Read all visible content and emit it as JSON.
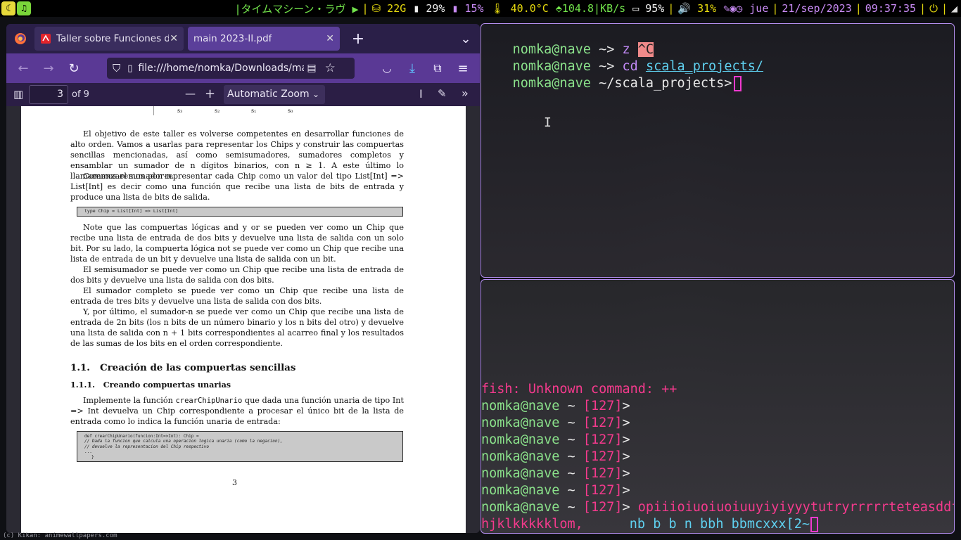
{
  "topbar": {
    "ws1_icon": "☾",
    "ws2_icon": "♫",
    "now_playing": "|タイムマシーン・ラヴ ▶",
    "disk": "⛁ 22G",
    "mem": "▮ 29%",
    "cpu": "▮ 15%",
    "temp": "🌡 40.0°C",
    "net": "⬘104.8|KB/s",
    "battery": "▭ 95%",
    "volume": "🔊 31%",
    "day": "jue",
    "date": "21/sep/2023",
    "time": "09:37:35",
    "power_icon": "⏻",
    "wifi_icon": "◢",
    "colors": {
      "pink": "#f53a8d",
      "yellow": "#e4d80e",
      "green": "#72e34b",
      "purple": "#c98bf5",
      "white": "#f0f0f0"
    }
  },
  "firefox": {
    "tabs": [
      {
        "label": "Taller sobre Funciones de A",
        "close": "✕"
      },
      {
        "label": "main 2023-II.pdf",
        "close": "✕"
      }
    ],
    "new_tab": "+",
    "tab_list": "⌄",
    "url": "file:///home/nomka/Downloads/ma",
    "pdf_toolbar": {
      "page_value": "3",
      "page_total": "of 9",
      "zoom": "Automatic Zoom",
      "zoom_out": "—",
      "zoom_in": "+"
    }
  },
  "pdf": {
    "signals": [
      "s₃",
      "s₂",
      "s₁",
      "s₀"
    ],
    "p1": "El objetivo de este taller es volverse competentes en desarrollar funciones de alto orden. Vamos a usarlas para representar los Chips y construir las compuertas sencillas mencionadas, así como semisumadores, sumadores completos y ensamblar un sumador de n dígitos binarios, con n ≥ 1. A este último lo llamaremos el sumador-n.",
    "p2": "Comenzaremos por representar cada Chip como un valor del tipo List[Int] => List[Int] es decir como una función que recibe una lista de bits de entrada y produce una lista de bits de salida.",
    "code1": "type Chip = List[Int] => List[Int]",
    "p3": "Note que las compuertas lógicas and y or se pueden ver como un Chip que recibe una lista de entrada de dos bits y devuelve una lista de salida con un solo bit. Por su lado, la compuerta lógica not se puede ver como un Chip que recibe una lista de entrada de un bit y devuelve una lista de salida con un bit.",
    "p4": "El semisumador se puede ver como un Chip que recibe una lista de entrada de dos bits y devuelve una lista de salida con dos bits.",
    "p5": "El sumador completo se puede ver como un Chip que recibe una lista de entrada de tres bits y devuelve una lista de salida con dos bits.",
    "p6": "Y, por último, el sumador-n se puede ver como un Chip que recibe una lista de entrada de 2n bits (los n bits de un número binario y los n bits del otro) y devuelve una lista de salida con n + 1 bits correspondientes al acarreo final y los resultados de las sumas de los bits en el orden correspondiente.",
    "h_num": "1.1.",
    "h_title": "Creación de las compuertas sencillas",
    "sh_num": "1.1.1.",
    "sh_title": "Creando compuertas unarias",
    "p7_a": "Implemente la función ",
    "p7_code": "crearChipUnario",
    "p7_b": " que dada una función unaria de tipo Int => Int devuelva un Chip correspondiente a procesar el único bit de la lista de entrada como lo indica la función unaria de entrada:",
    "code2": [
      "def crearChipUnario(funcion:Int=>Int): Chip =",
      "// Dada la funcion que calcula una operacion logica unaria (como la negacion),",
      "// devuelve la representacion del Chip respectivo",
      "...",
      "}"
    ],
    "page_number": "3"
  },
  "term1": {
    "lines": [
      {
        "user": "nomka@nave",
        "dir": " ~>",
        "cmd": " z",
        "extra": "^C"
      },
      {
        "user": "nomka@nave",
        "dir": " ~>",
        "cmd": " cd",
        "arg": "scala_projects/"
      },
      {
        "user": "nomka@nave",
        "dir": " ~/scala_projects>",
        "cmd": ""
      }
    ]
  },
  "term2": {
    "error": "fish: Unknown command: ++",
    "prompts": [
      {
        "user": "nomka@nave",
        "dir": " ~",
        "status": " [127]",
        "arrow": ">"
      },
      {
        "user": "nomka@nave",
        "dir": " ~",
        "status": " [127]",
        "arrow": ">"
      },
      {
        "user": "nomka@nave",
        "dir": " ~",
        "status": " [127]",
        "arrow": ">"
      },
      {
        "user": "nomka@nave",
        "dir": " ~",
        "status": " [127]",
        "arrow": ">"
      },
      {
        "user": "nomka@nave",
        "dir": " ~",
        "status": " [127]",
        "arrow": ">"
      },
      {
        "user": "nomka@nave",
        "dir": " ~",
        "status": " [127]",
        "arrow": ">"
      }
    ],
    "last_prompt": {
      "user": "nomka@nave",
      "dir": " ~",
      "status": " [127]",
      "arrow": ">"
    },
    "typed_1": " opiiioiuoiuoiuuyiyiyyytutryrrrrrteteasddfg",
    "typed_2a": "hjklkkkkklom,",
    "typed_2b": "nb b b n bbh bbmcxxx[2~"
  },
  "wallpaper_credit": "(c) Kikan:      animewallpapers.com"
}
